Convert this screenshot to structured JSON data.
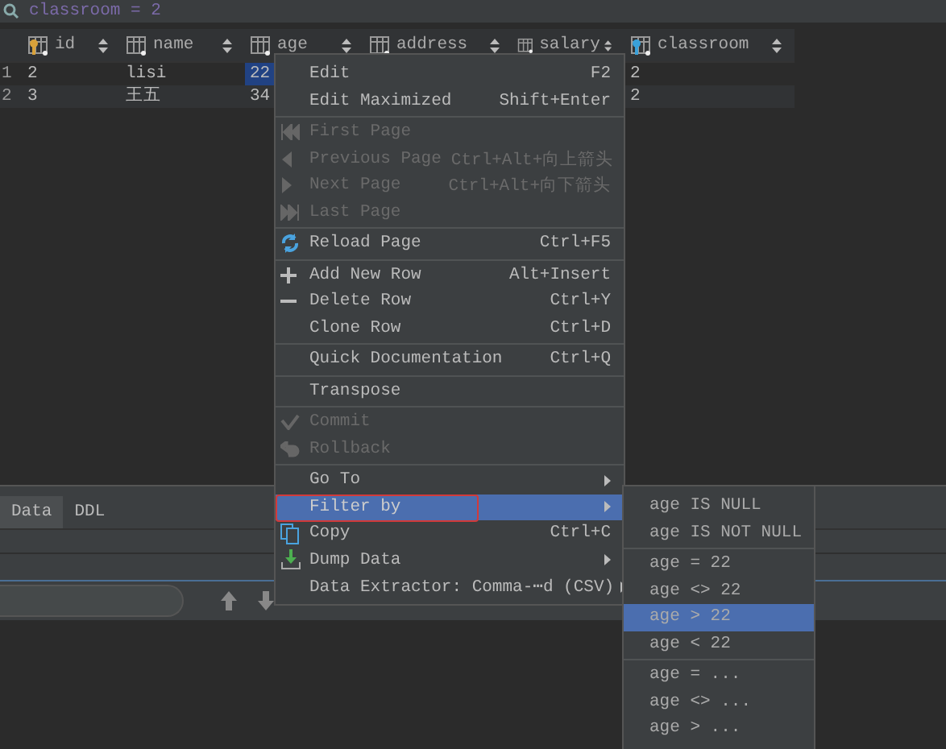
{
  "filter_bar": {
    "text": "classroom = 2"
  },
  "table": {
    "columns": [
      {
        "label": "id"
      },
      {
        "label": "name"
      },
      {
        "label": "age"
      },
      {
        "label": "address"
      },
      {
        "label": "salary"
      },
      {
        "label": "classroom"
      }
    ],
    "rows": [
      {
        "number": "1",
        "cells": [
          {
            "text": "2",
            "selected": false
          },
          {
            "text": "lisi",
            "selected": false
          },
          {
            "text": "22",
            "selected": true
          },
          {
            "text": "2",
            "selected": false
          }
        ]
      },
      {
        "number": "2",
        "cells": [
          {
            "text": "3",
            "selected": false
          },
          {
            "text": "王五",
            "selected": false
          },
          {
            "text": "34",
            "selected": false
          },
          {
            "text": "2",
            "selected": false
          }
        ]
      }
    ]
  },
  "bottom_tabs": [
    {
      "label": "Data",
      "selected": true
    },
    {
      "label": "DDL",
      "selected": false
    }
  ],
  "context_menu": {
    "items": [
      {
        "kind": "item",
        "label": "Edit",
        "shortcut": "F2",
        "disabled": false,
        "selected": false,
        "submenu": false
      },
      {
        "kind": "item",
        "label": "Edit Maximized",
        "shortcut": "Shift+Enter",
        "disabled": false,
        "selected": false,
        "submenu": false
      },
      {
        "kind": "separator"
      },
      {
        "kind": "item",
        "label": "First Page",
        "disabled": true,
        "selected": false,
        "submenu": false
      },
      {
        "kind": "item",
        "label": "Previous Page",
        "shortcut": "Ctrl+Alt+向上箭头",
        "disabled": true,
        "selected": false,
        "submenu": false
      },
      {
        "kind": "item",
        "label": "Next Page",
        "shortcut": "Ctrl+Alt+向下箭头",
        "disabled": true,
        "selected": false,
        "submenu": false
      },
      {
        "kind": "item",
        "label": "Last Page",
        "disabled": true,
        "selected": false,
        "submenu": false
      },
      {
        "kind": "separator"
      },
      {
        "kind": "item",
        "label": "Reload Page",
        "shortcut": "Ctrl+F5",
        "disabled": false,
        "selected": false,
        "submenu": false
      },
      {
        "kind": "separator"
      },
      {
        "kind": "item",
        "label": "Add New Row",
        "shortcut": "Alt+Insert",
        "disabled": false,
        "selected": false,
        "submenu": false
      },
      {
        "kind": "item",
        "label": "Delete Row",
        "shortcut": "Ctrl+Y",
        "disabled": false,
        "selected": false,
        "submenu": false
      },
      {
        "kind": "item",
        "label": "Clone Row",
        "shortcut": "Ctrl+D",
        "disabled": false,
        "selected": false,
        "submenu": false
      },
      {
        "kind": "separator"
      },
      {
        "kind": "item",
        "label": "Quick Documentation",
        "shortcut": "Ctrl+Q",
        "disabled": false,
        "selected": false,
        "submenu": false
      },
      {
        "kind": "separator"
      },
      {
        "kind": "item",
        "label": "Transpose",
        "disabled": false,
        "selected": false,
        "submenu": false
      },
      {
        "kind": "separator"
      },
      {
        "kind": "item",
        "label": "Commit",
        "disabled": true,
        "selected": false,
        "submenu": false
      },
      {
        "kind": "item",
        "label": "Rollback",
        "disabled": true,
        "selected": false,
        "submenu": false
      },
      {
        "kind": "separator"
      },
      {
        "kind": "item",
        "label": "Go To",
        "disabled": false,
        "selected": false,
        "submenu": true
      },
      {
        "kind": "item",
        "label": "Filter by",
        "disabled": false,
        "selected": true,
        "submenu": true
      },
      {
        "kind": "item",
        "label": "Copy",
        "shortcut": "Ctrl+C",
        "disabled": false,
        "selected": false,
        "submenu": false
      },
      {
        "kind": "item",
        "label": "Dump Data",
        "disabled": false,
        "selected": false,
        "submenu": true
      },
      {
        "kind": "item",
        "label": "Data Extractor: Comma-⋯d (CSV)",
        "disabled": false,
        "selected": false,
        "submenu": true
      }
    ]
  },
  "submenu": {
    "items": [
      {
        "kind": "item",
        "label": "age IS NULL",
        "selected": false
      },
      {
        "kind": "item",
        "label": "age IS NOT NULL",
        "selected": false
      },
      {
        "kind": "separator"
      },
      {
        "kind": "item",
        "label": "age = 22",
        "selected": false
      },
      {
        "kind": "item",
        "label": "age <> 22",
        "selected": false
      },
      {
        "kind": "item",
        "label": "age > 22",
        "selected": true
      },
      {
        "kind": "item",
        "label": "age < 22",
        "selected": false
      },
      {
        "kind": "separator"
      },
      {
        "kind": "item",
        "label": "age = ...",
        "selected": false
      },
      {
        "kind": "item",
        "label": "age <> ...",
        "selected": false
      },
      {
        "kind": "item",
        "label": "age > ...",
        "selected": false
      }
    ]
  }
}
